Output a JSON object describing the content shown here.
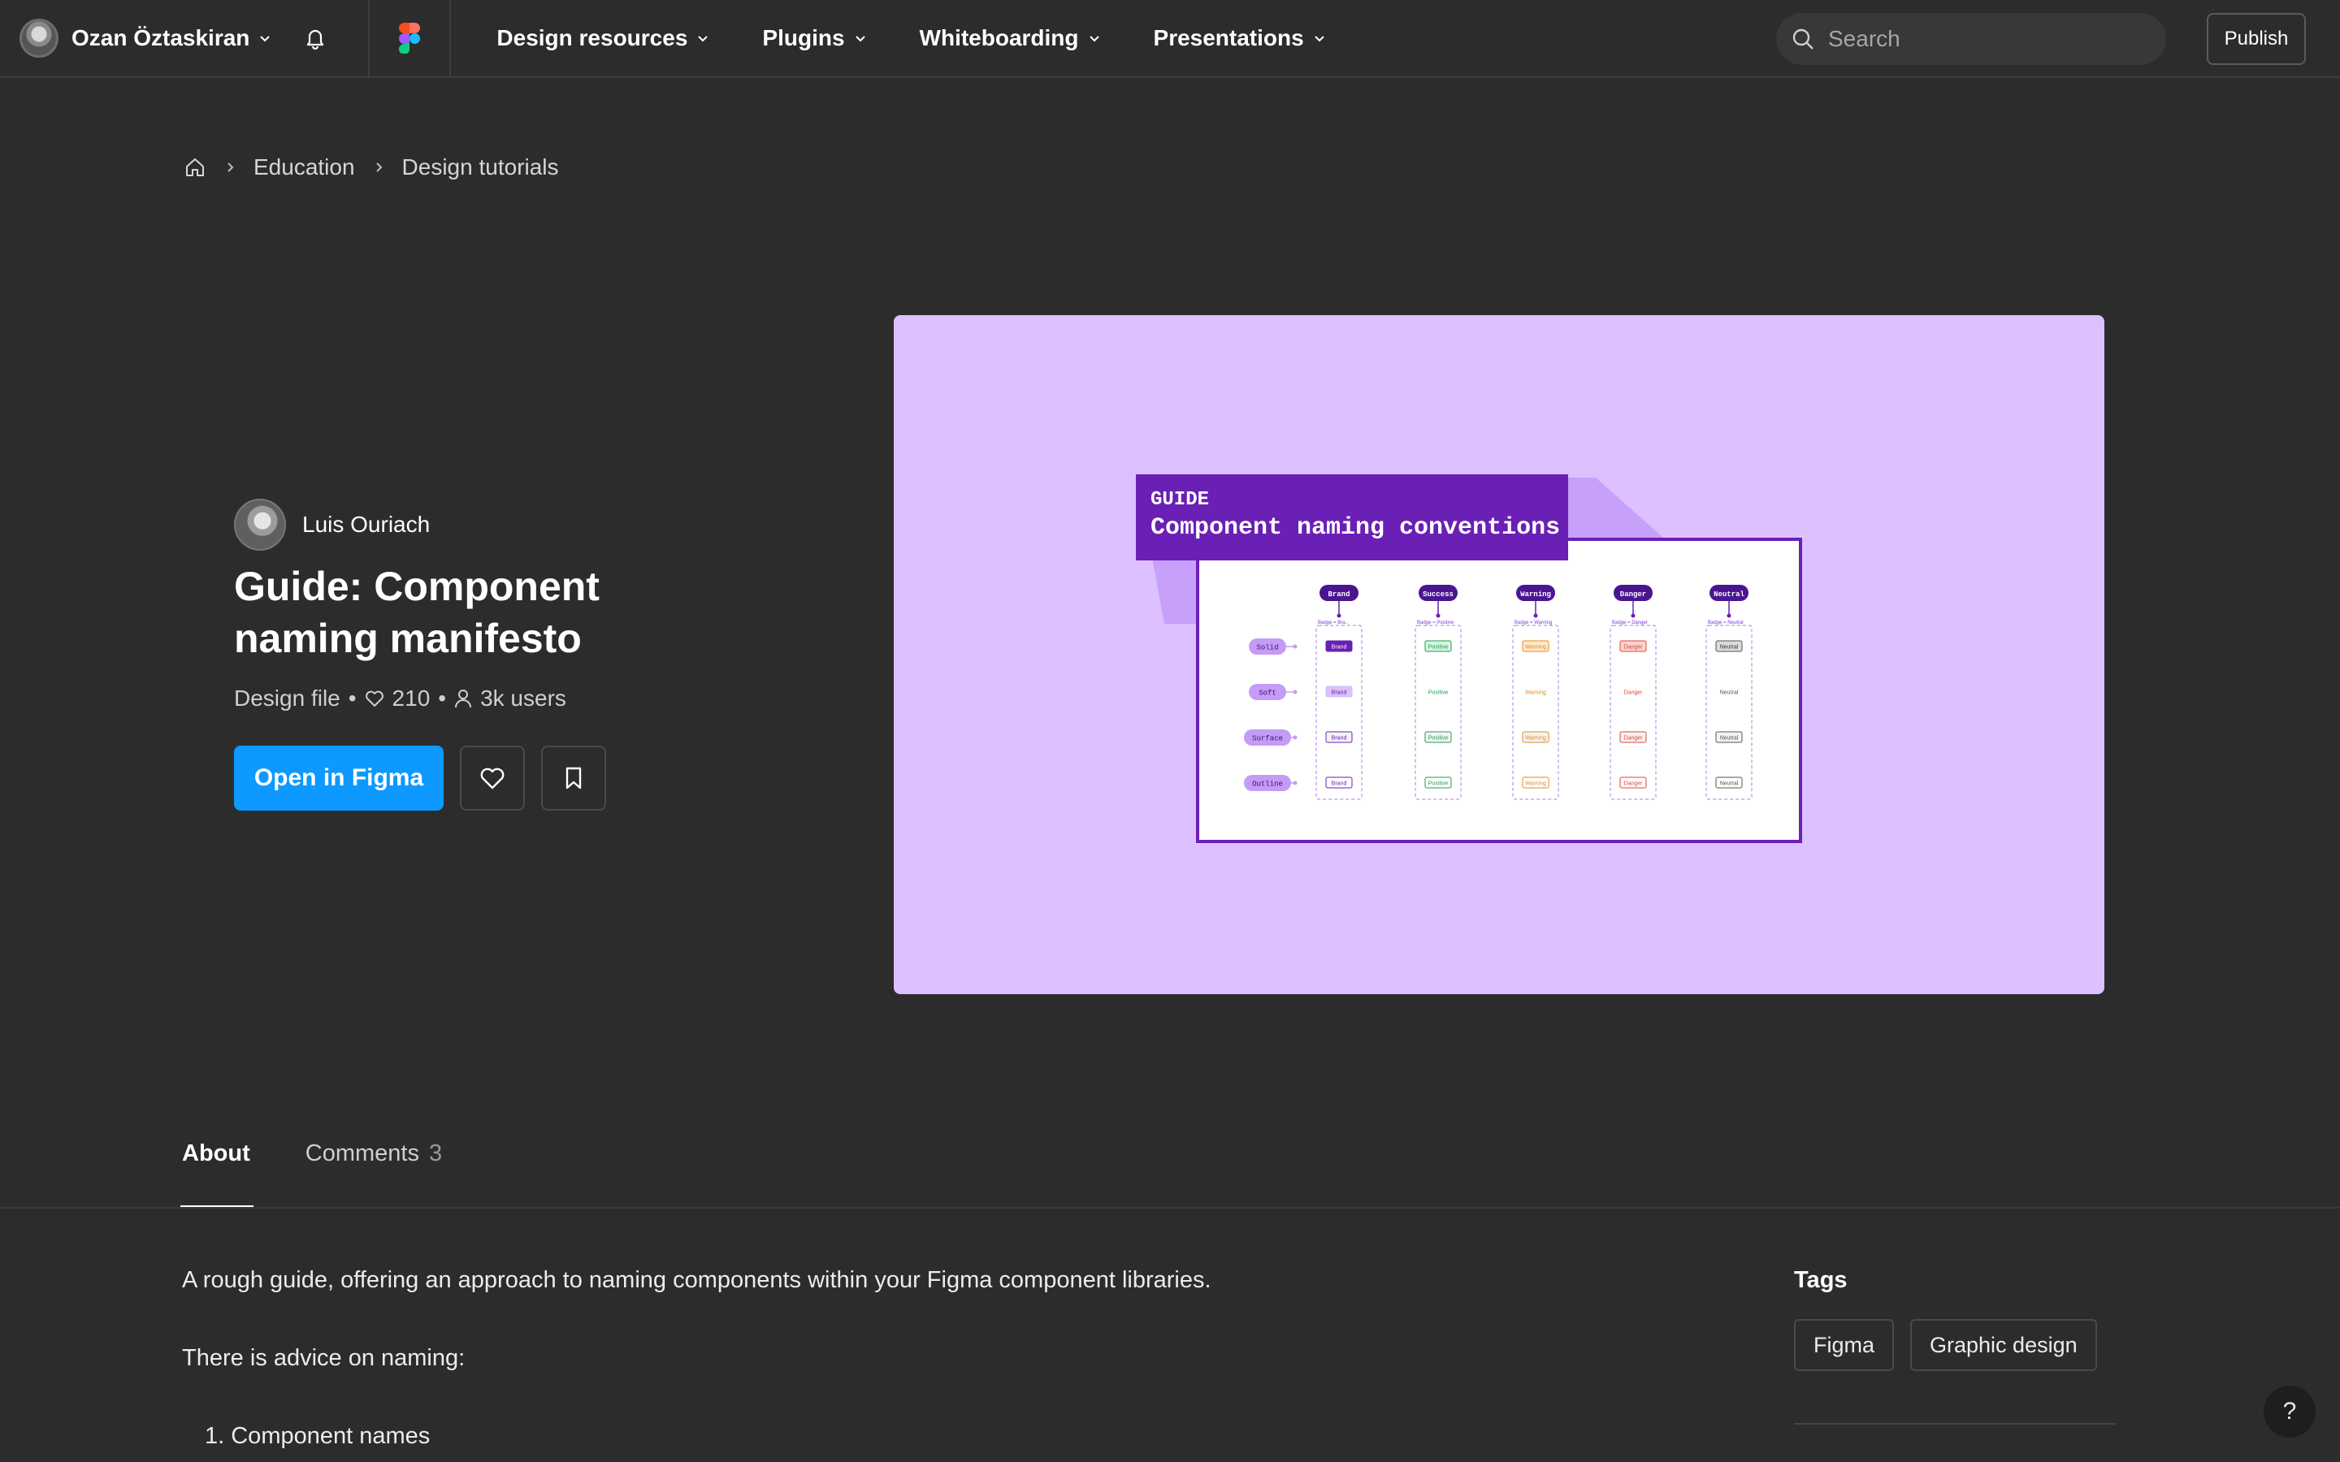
{
  "topbar": {
    "user_name": "Ozan Öztaskiran",
    "nav": [
      {
        "label": "Design resources"
      },
      {
        "label": "Plugins"
      },
      {
        "label": "Whiteboarding"
      },
      {
        "label": "Presentations"
      }
    ],
    "search_placeholder": "Search",
    "publish_label": "Publish"
  },
  "breadcrumb": {
    "items": [
      "Education",
      "Design tutorials"
    ]
  },
  "file": {
    "author": "Luis Ouriach",
    "title": "Guide: Component naming manifesto",
    "type": "Design file",
    "likes": "210",
    "users": "3k users",
    "open_label": "Open in Figma"
  },
  "thumbnail": {
    "tag_line1": "GUIDE",
    "tag_line2": "Component naming conventions",
    "columns": [
      "Brand",
      "Success",
      "Warning",
      "Danger",
      "Neutral"
    ],
    "rows": [
      "Solid",
      "Soft",
      "Surface",
      "Outline"
    ],
    "column_captions": [
      "Badge = Bra..",
      "Badge = Positive",
      "Badge = Warning",
      "Badge = Danger",
      "Badge = Neutral"
    ],
    "badges": [
      "Brand",
      "Positive",
      "Warning",
      "Danger",
      "Neutral"
    ],
    "colors": {
      "Brand": "#6a1fb5",
      "Success": "#1f9d55",
      "Warning": "#e58a1f",
      "Danger": "#e0453a",
      "Neutral": "#555555"
    }
  },
  "tabs": [
    {
      "label": "About",
      "count": ""
    },
    {
      "label": "Comments",
      "count": "3"
    }
  ],
  "about": {
    "intro": "A rough guide, offering an approach to naming components within your Figma component libraries.",
    "advice": "There is advice on naming:",
    "list": [
      "1. Component names"
    ]
  },
  "tags": {
    "title": "Tags",
    "items": [
      "Figma",
      "Graphic design"
    ]
  },
  "help_label": "?"
}
